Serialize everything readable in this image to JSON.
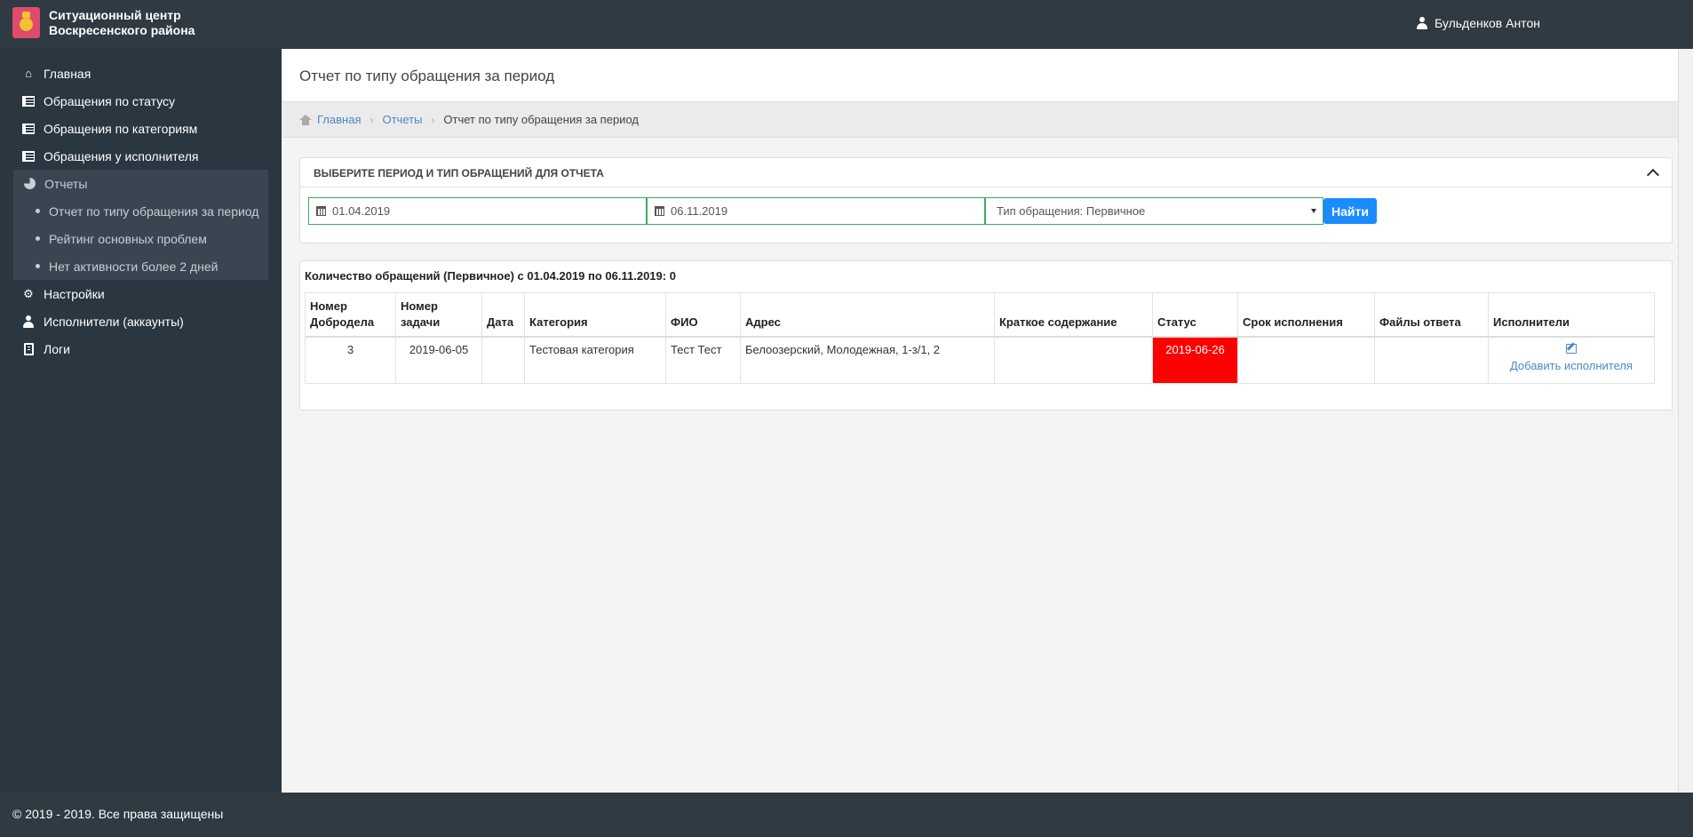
{
  "header": {
    "title_line1": "Ситуационный центр",
    "title_line2": "Воскресенского района",
    "user_name": "Бульденков Антон"
  },
  "sidebar": {
    "items": [
      {
        "label": "Главная",
        "icon": "home-icon"
      },
      {
        "label": "Обращения по статусу",
        "icon": "list-icon"
      },
      {
        "label": "Обращения по категориям",
        "icon": "list-icon"
      },
      {
        "label": "Обращения у исполнителя",
        "icon": "list-icon"
      },
      {
        "label": "Отчеты",
        "icon": "pie-chart-icon"
      },
      {
        "label": "Настройки",
        "icon": "gears-icon"
      },
      {
        "label": "Исполнители (аккаунты)",
        "icon": "user-icon"
      },
      {
        "label": "Логи",
        "icon": "clipboard-icon"
      }
    ],
    "reports_sub": [
      "Отчет по типу обращения за период",
      "Рейтинг основных проблем",
      "Нет активности более 2 дней"
    ]
  },
  "page": {
    "title": "Отчет по типу обращения за период",
    "breadcrumb": [
      "Главная",
      "Отчеты",
      "Отчет по типу обращения за период"
    ]
  },
  "filter": {
    "panel_title": "ВЫБЕРИТЕ ПЕРИОД И ТИП ОБРАЩЕНИЙ ДЛЯ ОТЧЕТА",
    "date_from": "01.04.2019",
    "date_to": "06.11.2019",
    "type_selected": "Тип обращения: Первичное",
    "find_label": "Найти"
  },
  "results": {
    "summary": "Количество обращений (Первичное) с 01.04.2019 по 06.11.2019: 0",
    "columns": [
      "Номер Добродела",
      "Номер задачи",
      "Дата",
      "Категория",
      "ФИО",
      "Адрес",
      "Краткое содержание",
      "Статус",
      "Срок исполнения",
      "Файлы ответа",
      "Исполнители"
    ],
    "rows": [
      {
        "dobrodel_no": "3",
        "task_no": "2019-06-05",
        "date": "",
        "category": "Тестовая категория",
        "fio": "Тест Тест",
        "address": "Белоозерский, Молодежная, 1-з/1, 2",
        "summary": "",
        "status": "2019-06-26",
        "deadline": "",
        "files": "",
        "assignees_action": "Добавить исполнителя"
      }
    ],
    "status_color": "#ff0000"
  },
  "footer": {
    "text": "© 2019 - 2019. Все права защищены"
  },
  "colors": {
    "header_bg": "#2f3a42",
    "sidebar_bg": "#2a3640",
    "accent": "#1a8cff",
    "link": "#4f86c6",
    "input_border": "#41a95d"
  }
}
